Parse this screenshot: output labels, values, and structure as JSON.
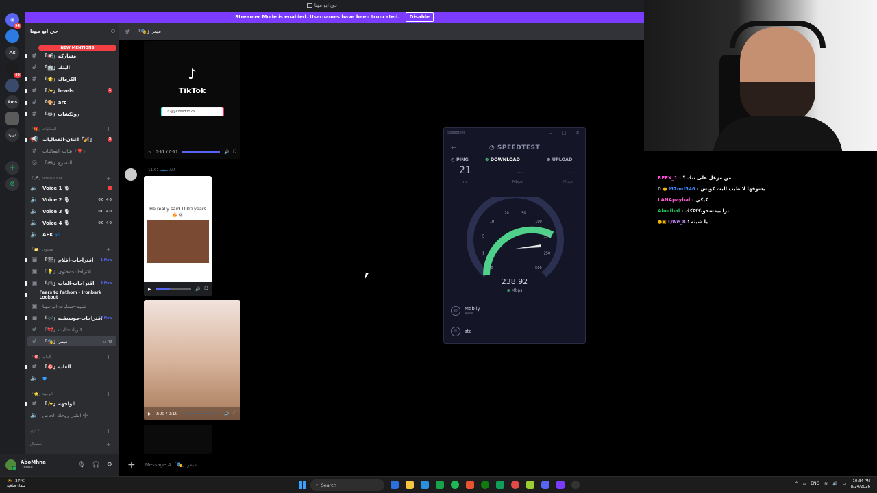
{
  "window": {
    "title": "حي ابو مهنا"
  },
  "banner": {
    "text": "Streamer Mode is enabled. Usernames have been truncated.",
    "disable_label": "Disable"
  },
  "rail": {
    "items": [
      {
        "label": "",
        "badge": "94"
      },
      {
        "label": "",
        "badge": ""
      },
      {
        "label": "As",
        "badge": ""
      },
      {
        "label": "",
        "badge": "49"
      },
      {
        "label": "",
        "badge": ""
      },
      {
        "label": "Ams",
        "badge": ""
      },
      {
        "label": "",
        "badge": ""
      },
      {
        "label": "ابوبها",
        "badge": ""
      }
    ]
  },
  "sidebar": {
    "server_name": "حي ابو مهنا",
    "new_mentions": "NEW MENTIONS",
    "channels": [
      {
        "name": "「📢」مشاركة",
        "type": "text",
        "state": "unread"
      },
      {
        "name": "「🏢」البنك",
        "type": "text",
        "state": "unread"
      },
      {
        "name": "「🌟」الكرماك",
        "type": "text",
        "state": "unread"
      },
      {
        "name": "「✨」levels",
        "type": "text",
        "state": "unread",
        "count": "1"
      },
      {
        "name": "「🎨」art",
        "type": "text",
        "state": "unread"
      },
      {
        "name": "「😂」رولكشات",
        "type": "text",
        "state": "unread"
      }
    ],
    "cat_events": "「🎁」الفعاليات",
    "event_channels": [
      {
        "name": "اعلان-الفعاليات「🎉」",
        "type": "announce",
        "count": "3",
        "state": "unread"
      },
      {
        "name": "شات-الفعاليات「🎈」",
        "type": "text",
        "state": "muted"
      },
      {
        "name": "「🎮」النشرع",
        "type": "voice",
        "state": "muted"
      }
    ],
    "cat_voice": "「🎤」Voice Chat",
    "voice_channels": [
      {
        "name": "Voice 1 🎙",
        "count": "1"
      },
      {
        "name": "Voice 2 🎙",
        "limit": "00 40"
      },
      {
        "name": "Voice 3 🎙",
        "limit": "00 40"
      },
      {
        "name": "Voice 4 🎙",
        "limit": "00 40"
      },
      {
        "name": "AFK 💤",
        "limit": ""
      }
    ],
    "cat_content": "「📁」محتوى",
    "content_channels": [
      {
        "name": "「🎬」اقتراحات-افلام",
        "tag": "1 New",
        "state": "unread",
        "type": "forum"
      },
      {
        "name": "「💡」اقتراحات-محتوى",
        "state": "muted",
        "type": "forum"
      },
      {
        "name": "「🎮」اقتراحات-العاب",
        "tag": "3 New",
        "state": "unread",
        "type": "forum"
      },
      {
        "name": "Fears to Fathom - Ironbark Lookout",
        "state": "thread",
        "type": "thread"
      },
      {
        "name": "تقييم-حسابات-ابو-مهنا",
        "state": "muted",
        "type": "forum"
      },
      {
        "name": "「🎶」اقتراحات-موسيقيه",
        "tag": "7 New",
        "state": "unread",
        "type": "forum"
      },
      {
        "name": "「🎀」كاريات-البث",
        "state": "muted",
        "type": "text"
      },
      {
        "name": "「🎭」ميمز",
        "state": "selected",
        "type": "text"
      }
    ],
    "cat_games": "「🎯」ألعاب",
    "game_channels": [
      {
        "name": "「🎯」ألعاب",
        "state": "unread",
        "type": "text"
      },
      {
        "name": "",
        "state": "unread",
        "type": "voice"
      }
    ],
    "cat_lounge": "「🌟」الوجهة",
    "lounge_channels": [
      {
        "name": "「✨」الواجهة",
        "state": "unread",
        "type": "text"
      },
      {
        "name": "انشي روحك الخاص ➕",
        "state": "muted",
        "type": "voice"
      }
    ],
    "cat_thanks": "شكري",
    "cat_last": "استقبال"
  },
  "user": {
    "name": "AboMhna",
    "status": "Online"
  },
  "chat": {
    "header": "「🎭」ميمز",
    "placeholder": "Message #「🎭」ميمز",
    "video1": {
      "brand": "TikTok",
      "search_text": "yazeed.f526",
      "time": "0:11 / 0:11",
      "progress": 1.0
    },
    "message": {
      "author": "ضيف",
      "time": "11:01 AM",
      "caption": "He really said 1000 years 🔥💀"
    },
    "video3": {
      "time": "0:00 / 0:10",
      "progress": 0.0
    }
  },
  "speedtest": {
    "window_title": "Speedtest",
    "brand": "SPEEDTEST",
    "tabs": {
      "ping": "PING",
      "download": "DOWNLOAD",
      "upload": "UPLOAD"
    },
    "ping_value": "21",
    "ping_unit": "ms",
    "download_value": "...",
    "download_unit": "Mbps",
    "upload_value": "...",
    "upload_unit": "Mbps",
    "speed": "238.92",
    "speed_unit": "Mbps",
    "gauge_ticks": [
      "0",
      "1",
      "5",
      "10",
      "20",
      "50",
      "100",
      "150",
      "250",
      "500"
    ],
    "isp": {
      "name": "Mobily",
      "sub": "Ajoul"
    },
    "server": {
      "name": "stc"
    }
  },
  "twitch_chat": [
    {
      "user": "REEX_1",
      "color": "#ff4fd8",
      "text": "من مزغل على نتك ؟"
    },
    {
      "user": "M7md546",
      "color": "#3b82f6",
      "text": "يسوقها لا طيب البث كويس",
      "badge": "0"
    },
    {
      "user": "LANApaybal",
      "color": "#ff5fd2",
      "text": "كيكي"
    },
    {
      "user": "Almdbal",
      "color": "#22c55e",
      "text": "ترا بيمسحوتككككك"
    },
    {
      "user": "Qwe_8",
      "color": "#c084fc",
      "text": "يا شينه"
    }
  ],
  "taskbar": {
    "weather_temp": "37°C",
    "weather_desc": "سماء صافية",
    "search": "Search",
    "lang": "ENG",
    "time": "10:34 PM",
    "date": "8/24/2026"
  },
  "colors": {
    "banner": "#7b3cff",
    "accent": "#5865f2",
    "speed_green": "#4fd18b",
    "mention_red": "#f23f43"
  }
}
